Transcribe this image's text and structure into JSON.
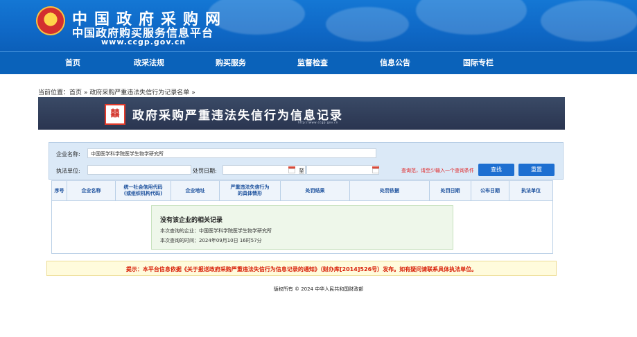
{
  "header": {
    "title": "中国政府采购网",
    "subtitle": "中国政府购买服务信息平台",
    "url": "www.ccgp.gov.cn"
  },
  "nav": {
    "items": [
      "首页",
      "政采法规",
      "购买服务",
      "监督检查",
      "信息公告",
      "国际专栏"
    ]
  },
  "breadcrumb": {
    "prefix": "当前位置：",
    "home": "首页",
    "sep1": "»",
    "current": "政府采购严重违法失信行为记录名单",
    "sep2": "»"
  },
  "banner": {
    "title": "政府采购严重违法失信行为信息记录",
    "url": "http://www.ccgp.gov.cn",
    "seal_char": "囍"
  },
  "search": {
    "company_label": "企业名称:",
    "company_value": "中国医学科学院医学生物学研究所",
    "enforce_label": "执法单位:",
    "enforce_value": "",
    "date_label": "处罚日期:",
    "date_from": "",
    "to_label": "至",
    "date_to": "",
    "hint": "查询范，请至少输入一个查询条件",
    "search_btn": "查找",
    "reset_btn": "重置"
  },
  "table": {
    "headers": [
      "序号",
      "企业名称",
      "统一社会信用代码\n(或组织机构代码)",
      "企业地址",
      "严重违法失信行为\n的具体情形",
      "处罚结果",
      "处罚依据",
      "处罚日期",
      "公布日期",
      "执法单位"
    ]
  },
  "no_result": {
    "title": "没有该企业的相关记录",
    "line1": "本次查询的企业：中国医学科学院医学生物学研究所",
    "line2": "本次查询的时间：2024年09月10日 16时57分"
  },
  "notice": {
    "text": "提示：本平台信息依据《关于报送政府采购严重违法失信行为信息记录的通知》（财办库[2014]526号）发布。如有疑问请联系具体执法单位。"
  },
  "footer": {
    "text": "版权所有 © 2024 中华人民共和国财政部"
  },
  "colors": {
    "header_blue": "#1477d4",
    "nav_blue": "#0a62ba",
    "banner_dark": "#2a3550",
    "button_blue": "#1d6fd1",
    "alert_red": "#d81e06"
  }
}
